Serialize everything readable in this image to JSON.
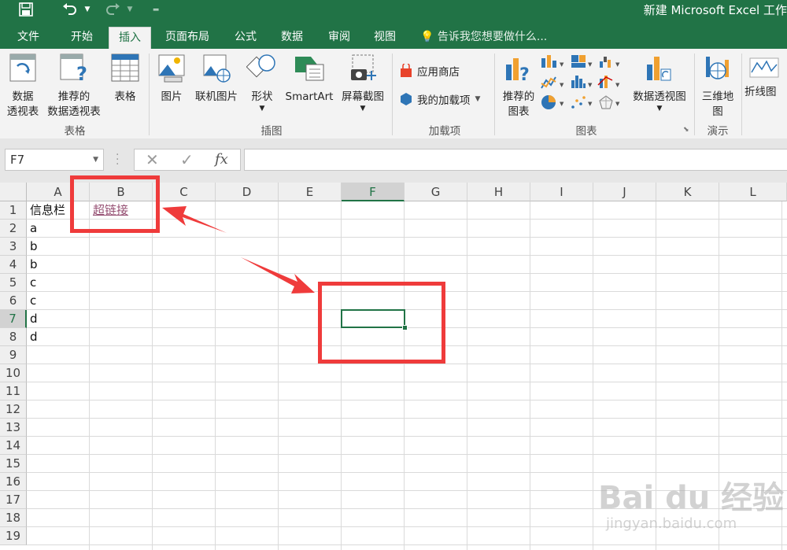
{
  "titlebar": {
    "title": "新建 Microsoft Excel 工作",
    "save_icon": "save-icon",
    "undo_icon": "undo-icon",
    "redo_icon": "redo-icon",
    "customize_icon": "customize-qat-icon"
  },
  "tabs": [
    {
      "label": "文件"
    },
    {
      "label": "开始"
    },
    {
      "label": "插入"
    },
    {
      "label": "页面布局"
    },
    {
      "label": "公式"
    },
    {
      "label": "数据"
    },
    {
      "label": "审阅"
    },
    {
      "label": "视图"
    }
  ],
  "active_tab": "插入",
  "tell_me": "告诉我您想要做什么...",
  "ribbon": {
    "tables": {
      "pivot_line1": "数据",
      "pivot_line2": "透视表",
      "rec_pivot_line1": "推荐的",
      "rec_pivot_line2": "数据透视表",
      "table": "表格",
      "group": "表格"
    },
    "illustrations": {
      "pictures": "图片",
      "online_pictures": "联机图片",
      "shapes": "形状",
      "smartart": "SmartArt",
      "screenshot": "屏幕截图",
      "group": "插图"
    },
    "addins": {
      "store": "应用商店",
      "my_addins": "我的加载项",
      "group": "加载项"
    },
    "charts": {
      "rec_line1": "推荐的",
      "rec_line2": "图表",
      "pivot_chart": "数据透视图",
      "group": "图表"
    },
    "tours": {
      "map_line1": "三维地",
      "map_line2": "图",
      "group": "演示"
    },
    "sparklines": {
      "line": "折线图"
    }
  },
  "formula_bar": {
    "name_box": "F7",
    "cancel": "✕",
    "enter": "✓",
    "fx": "fx",
    "value": ""
  },
  "columns": [
    "A",
    "B",
    "C",
    "D",
    "E",
    "F",
    "G",
    "H",
    "I",
    "J",
    "K",
    "L"
  ],
  "rows": [
    "1",
    "2",
    "3",
    "4",
    "5",
    "6",
    "7",
    "8",
    "9",
    "10",
    "11",
    "12",
    "13",
    "14",
    "15",
    "16",
    "17",
    "18",
    "19"
  ],
  "selected_cell": {
    "col": "F",
    "row": "7"
  },
  "cells": {
    "A1": "信息栏",
    "B1": "超链接",
    "A2": "a",
    "A3": "b",
    "A4": "b",
    "A5": "c",
    "A6": "c",
    "A7": "d",
    "A8": "d"
  },
  "watermark": {
    "logo": "Bai du 经验",
    "url": "jingyan.baidu.com"
  },
  "colors": {
    "excel_green": "#217346",
    "annotation_red": "#ef3b3b",
    "link_purple": "#954f72"
  }
}
